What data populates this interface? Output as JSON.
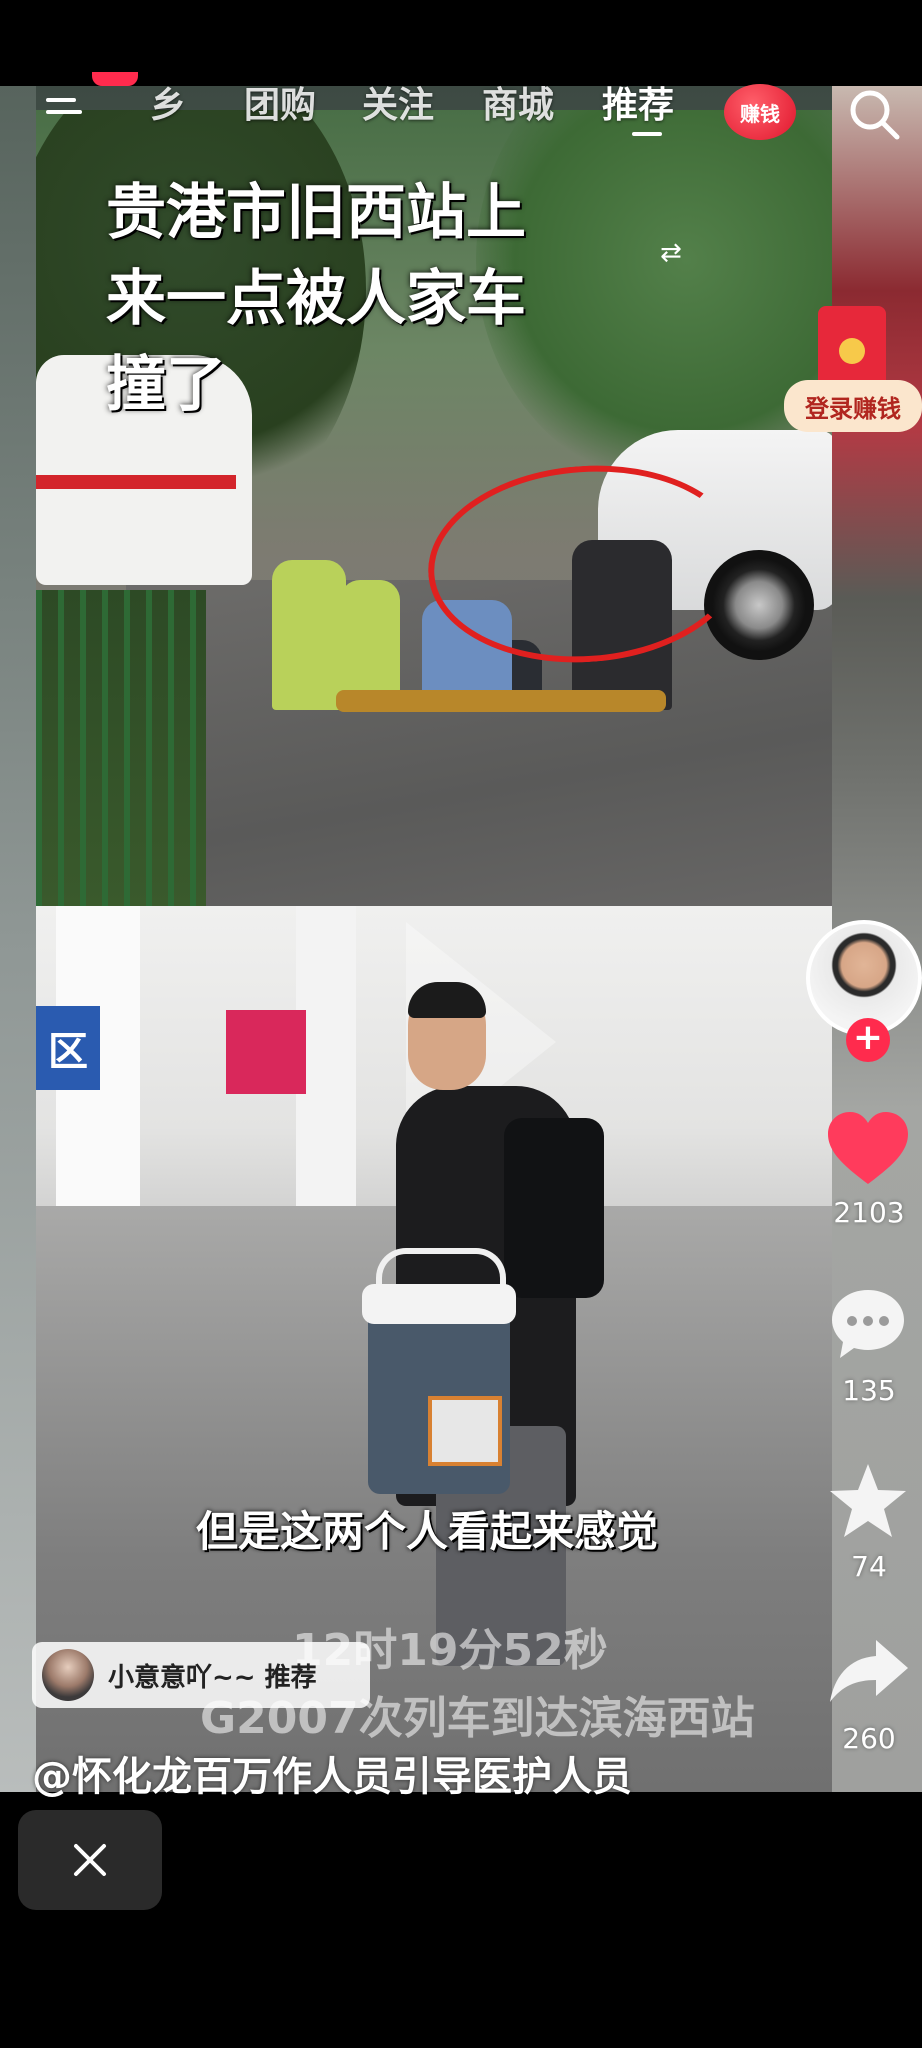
{
  "nav": {
    "tabs": [
      {
        "label": "乡"
      },
      {
        "label": "团购"
      },
      {
        "label": "关注"
      },
      {
        "label": "商城"
      },
      {
        "label": "推荐"
      }
    ],
    "earn_badge": "赚钱"
  },
  "promo": {
    "login_earn": "登录赚钱"
  },
  "video": {
    "headline": "贵港市旧西站上\n来一点被人家车\n撞了",
    "subtitle": "但是这两个人看起来感觉",
    "ghost_caption_time": "12时19分52秒",
    "ghost_caption_line2": "G2007次列车到达滨海西站",
    "author_line": "@怀化龙百万作人员引导医护人员",
    "scene_sign": "区"
  },
  "recommend_chip": {
    "text": "小意意吖~~ 推荐"
  },
  "rail": {
    "likes": "2103",
    "comments": "135",
    "favorites": "74",
    "shares": "260"
  },
  "icons": [
    "menu-icon",
    "search-icon",
    "swap-icon",
    "heart-icon",
    "comment-icon",
    "star-icon",
    "share-icon",
    "close-icon",
    "plus-icon",
    "red-packet-icon"
  ],
  "colors": {
    "accent_red": "#ff2b4d",
    "earn_badge": "#e0152c",
    "login_earn_bg": "#fbe6cd",
    "annotation_circle": "#e0201f"
  }
}
